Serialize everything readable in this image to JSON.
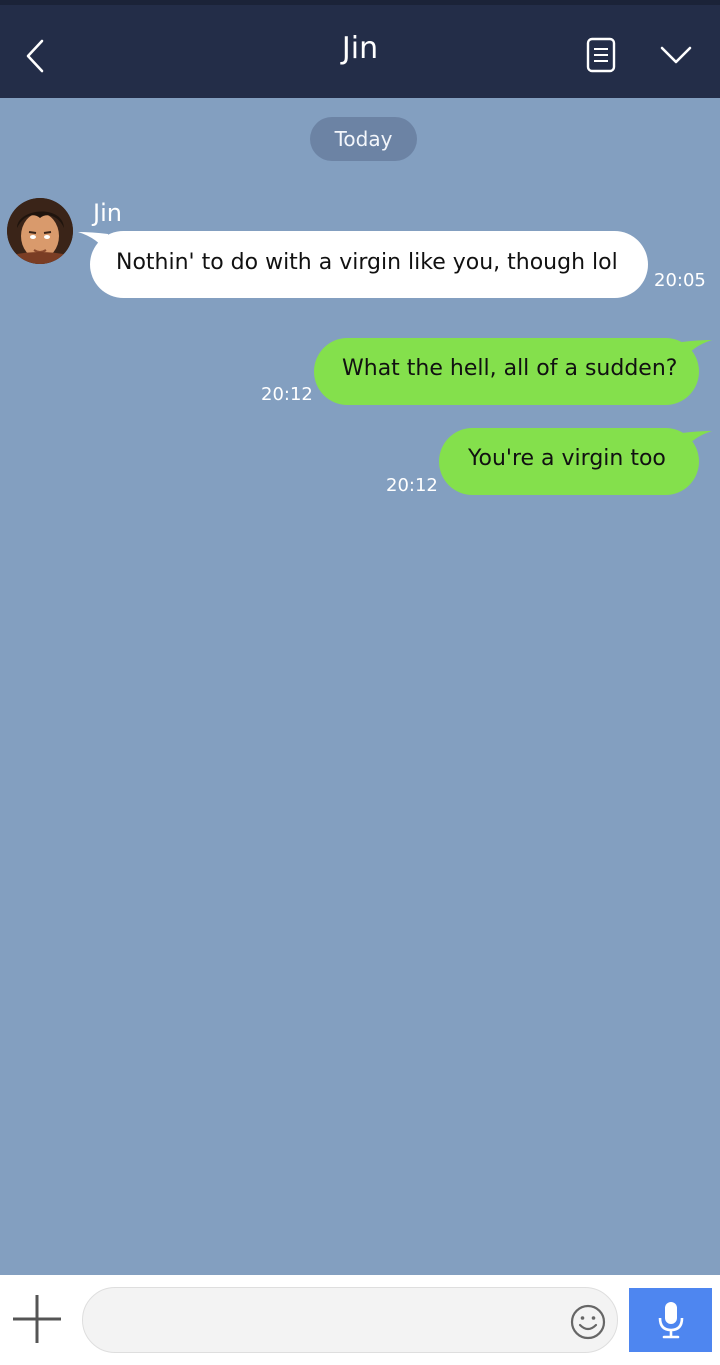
{
  "header": {
    "title": "Jin",
    "back_icon": "chevron-left-icon",
    "notes_icon": "note-icon",
    "menu_icon": "chevron-down-icon",
    "background": "#232d48"
  },
  "chat": {
    "background": "#839fc0",
    "date_label": "Today",
    "messages": [
      {
        "direction": "incoming",
        "sender": "Jin",
        "text": "Nothin' to do with a virgin like you, though lol",
        "time": "20:05"
      },
      {
        "direction": "outgoing",
        "text": "What the hell, all of a sudden?",
        "time": "20:12"
      },
      {
        "direction": "outgoing",
        "text": "You're a virgin too",
        "time": "20:12"
      }
    ]
  },
  "input_bar": {
    "add_icon": "plus-icon",
    "message_value": "",
    "placeholder": "",
    "emoji_icon": "smiley-icon",
    "voice_icon": "microphone-icon",
    "accent": "#4e86f0"
  },
  "colors": {
    "incoming_bubble": "#ffffff",
    "outgoing_bubble": "#84e04c"
  }
}
